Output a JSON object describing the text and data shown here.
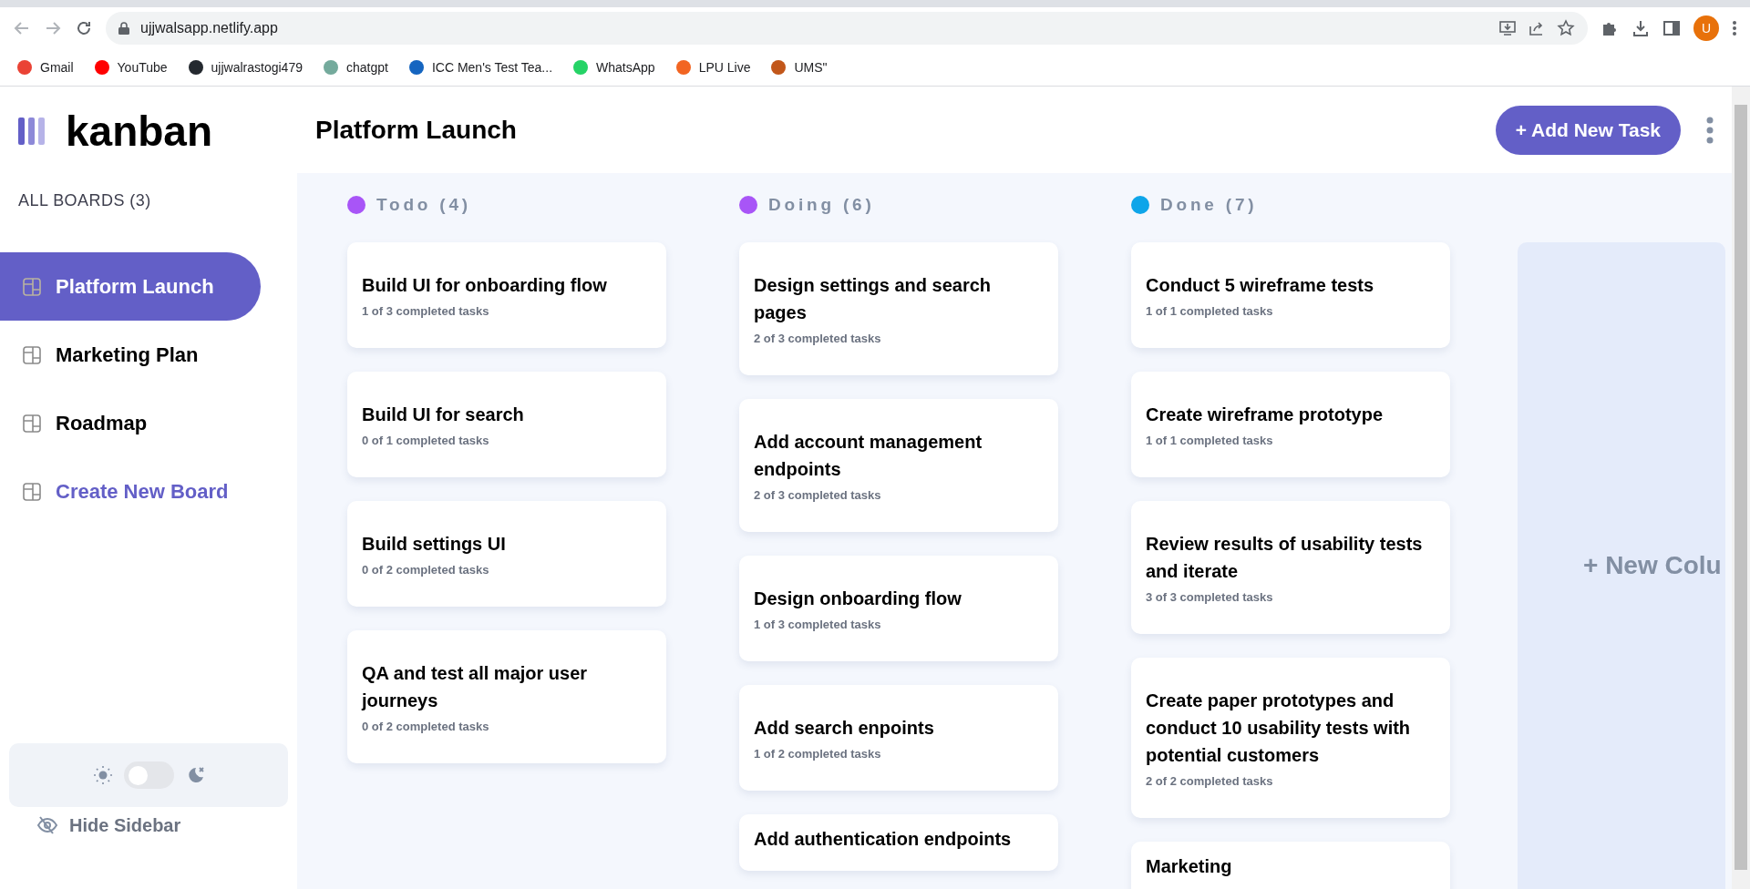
{
  "browser": {
    "url": "ujjwalsapp.netlify.app",
    "avatar": "U",
    "bookmarks": [
      {
        "label": "Gmail",
        "color": "#ea4335"
      },
      {
        "label": "YouTube",
        "color": "#ff0000"
      },
      {
        "label": "ujjwalrastogi479",
        "color": "#24292f"
      },
      {
        "label": "chatgpt",
        "color": "#74aa9c"
      },
      {
        "label": "ICC Men's Test Tea...",
        "color": "#1565c0"
      },
      {
        "label": "WhatsApp",
        "color": "#25d366"
      },
      {
        "label": "LPU Live",
        "color": "#f26522"
      },
      {
        "label": "UMS\"",
        "color": "#c2571a"
      }
    ]
  },
  "logo": "kanban",
  "sidebar": {
    "heading": "ALL BOARDS (3)",
    "items": [
      {
        "kind": "board",
        "label": "Platform Launch",
        "selected": true
      },
      {
        "kind": "board",
        "label": "Marketing Plan",
        "selected": false
      },
      {
        "kind": "board",
        "label": "Roadmap",
        "selected": false
      },
      {
        "kind": "create",
        "label": "Create New Board",
        "selected": false
      }
    ],
    "theme_toggle": {
      "on": false
    },
    "hide_label": "Hide Sidebar"
  },
  "header": {
    "title": "Platform Launch",
    "add_button": "+ Add New Task"
  },
  "columns": [
    {
      "name": "Todo (4)",
      "color": "#a855f7",
      "cards": [
        {
          "title": "Build UI for onboarding flow",
          "subtitle": "1 of 3 completed tasks"
        },
        {
          "title": "Build UI for search",
          "subtitle": "0 of 1 completed tasks"
        },
        {
          "title": "Build settings UI",
          "subtitle": "0 of 2 completed tasks"
        },
        {
          "title": "QA and test all major user journeys",
          "subtitle": "0 of 2 completed tasks"
        }
      ]
    },
    {
      "name": "Doing (6)",
      "color": "#a855f7",
      "cards": [
        {
          "title": "Design settings and search pages",
          "subtitle": "2 of 3 completed tasks"
        },
        {
          "title": "Add account management endpoints",
          "subtitle": "2 of 3 completed tasks"
        },
        {
          "title": "Design onboarding flow",
          "subtitle": "1 of 3 completed tasks"
        },
        {
          "title": "Add search enpoints",
          "subtitle": "1 of 2 completed tasks"
        },
        {
          "title": "Add authentication endpoints"
        }
      ]
    },
    {
      "name": "Done (7)",
      "color": "#0ea5e9",
      "cards": [
        {
          "title": "Conduct 5 wireframe tests",
          "subtitle": "1 of 1 completed tasks"
        },
        {
          "title": "Create wireframe prototype",
          "subtitle": "1 of 1 completed tasks"
        },
        {
          "title": "Review results of usability tests and iterate",
          "subtitle": "3 of 3 completed tasks"
        },
        {
          "title": "Create paper prototypes and conduct 10 usability tests with potential customers",
          "subtitle": "2 of 2 completed tasks"
        },
        {
          "title": "Marketing"
        }
      ]
    }
  ],
  "new_column": "+ New Colu"
}
